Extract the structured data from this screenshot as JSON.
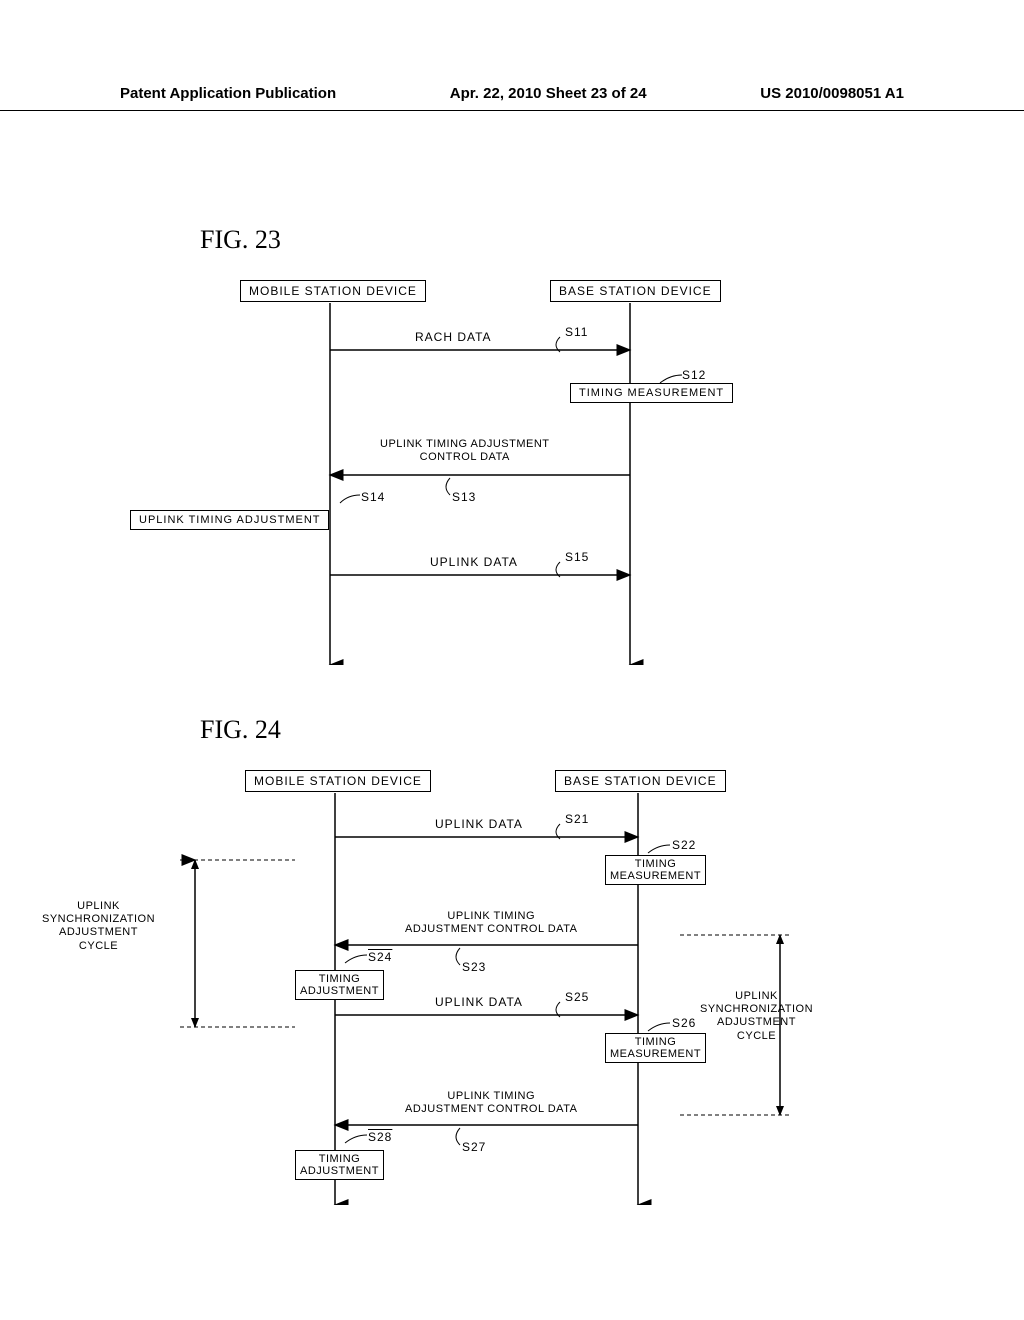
{
  "header": {
    "left": "Patent Application Publication",
    "center": "Apr. 22, 2010  Sheet 23 of 24",
    "right": "US 2010/0098051 A1"
  },
  "fig23": {
    "title": "FIG. 23",
    "mobile": "MOBILE STATION DEVICE",
    "base": "BASE STATION DEVICE",
    "s11": "S11",
    "s11_label": "RACH DATA",
    "s12": "S12",
    "s12_box": "TIMING MEASUREMENT",
    "s13": "S13",
    "s13_label1": "UPLINK TIMING ADJUSTMENT",
    "s13_label2": "CONTROL DATA",
    "s14": "S14",
    "s14_box": "UPLINK TIMING ADJUSTMENT",
    "s15": "S15",
    "s15_label": "UPLINK DATA"
  },
  "fig24": {
    "title": "FIG. 24",
    "mobile": "MOBILE STATION DEVICE",
    "base": "BASE STATION DEVICE",
    "s21": "S21",
    "s21_label": "UPLINK DATA",
    "s22": "S22",
    "s22_box": "TIMING\nMEASUREMENT",
    "s23": "S23",
    "s23_label1": "UPLINK TIMING",
    "s23_label2": "ADJUSTMENT CONTROL DATA",
    "s24": "S24",
    "s24_box": "TIMING\nADJUSTMENT",
    "s25": "S25",
    "s25_label": "UPLINK DATA",
    "s26": "S26",
    "s26_box": "TIMING\nMEASUREMENT",
    "s27": "S27",
    "s27_label1": "UPLINK TIMING",
    "s27_label2": "ADJUSTMENT CONTROL DATA",
    "s28": "S28",
    "s28_box": "TIMING\nADJUSTMENT",
    "left_cycle": "UPLINK\nSYNCHRONIZATION\nADJUSTMENT\nCYCLE",
    "right_cycle": "UPLINK\nSYNCHRONIZATION\nADJUSTMENT\nCYCLE"
  }
}
